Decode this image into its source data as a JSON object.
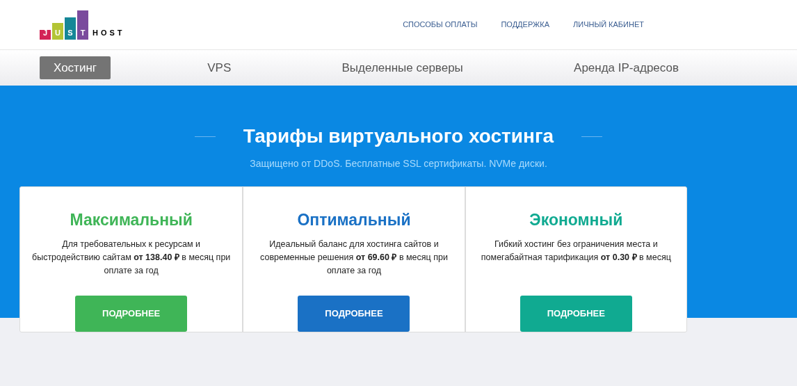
{
  "logo": {
    "letters": [
      {
        "char": "J",
        "color": "#d32356"
      },
      {
        "char": "U",
        "color": "#b3c435"
      },
      {
        "char": "S",
        "color": "#158797"
      },
      {
        "char": "T",
        "color": "#7a4b9d"
      }
    ],
    "word": "HOST"
  },
  "top_links": [
    "СПОСОБЫ ОПЛАТЫ",
    "ПОДДЕРЖКА",
    "ЛИЧНЫЙ КАБИНЕТ"
  ],
  "tabs": [
    {
      "label": "Хостинг",
      "selected": true
    },
    {
      "label": "VPS",
      "selected": false
    },
    {
      "label": "Выделенные серверы",
      "selected": false
    },
    {
      "label": "Аренда IP-адресов",
      "selected": false
    }
  ],
  "hero": {
    "title": "Тарифы виртуального хостинга",
    "subtitle": "Защищено от DDoS. Бесплатные SSL сертификаты. NVMe диски."
  },
  "plans": [
    {
      "name": "Максимальный",
      "color": "#3fb557",
      "description": "Для требовательных к ресурсам и быстродействию сайтам **от 138.40 ₽** в месяц при оплате за год",
      "button": "ПОДРОБНЕЕ"
    },
    {
      "name": "Оптимальный",
      "color": "#1a71c5",
      "description": "Идеальный баланс для хостинга сайтов и современные решения **от 69.60 ₽** в месяц при оплате за год",
      "button": "ПОДРОБНЕЕ"
    },
    {
      "name": "Экономный",
      "color": "#10aa91",
      "description": "Гибкий хостинг без ограничения места и помегабайтная тарификация **от 0.30 ₽** в месяц",
      "button": "ПОДРОБНЕЕ"
    }
  ]
}
